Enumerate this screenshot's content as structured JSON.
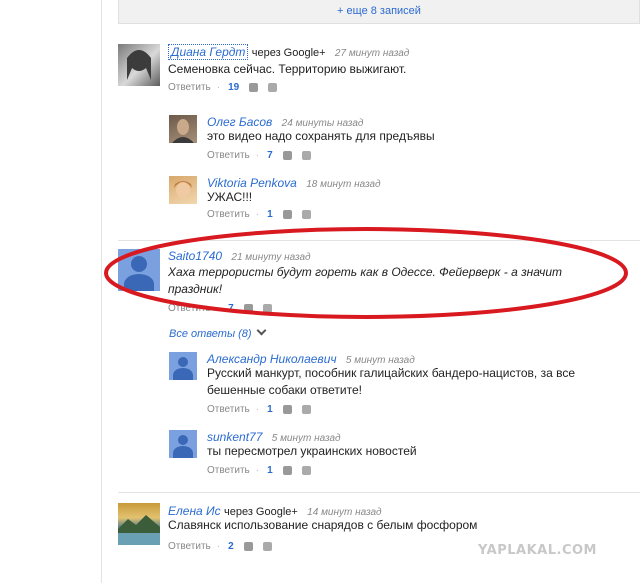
{
  "more_entries": "+ еще 8 записей",
  "reply_label": "Ответить",
  "all_answers": "Все ответы (8)",
  "watermark": "YAPLAKAL.COM",
  "comments": [
    {
      "name": "Диана Гердт",
      "via": "через Google+",
      "time": "27 минут назад",
      "text": "Семеновка сейчас. Территорию выжигают.",
      "likes": "19"
    },
    {
      "name": "Олег Басов",
      "via": "",
      "time": "24 минуты назад",
      "text": "это видео надо сохранять для предъявы",
      "likes": "7"
    },
    {
      "name": "Viktoria Penkova",
      "via": "",
      "time": "18 минут назад",
      "text": "УЖАС!!!",
      "likes": "1"
    },
    {
      "name": "Saito1740",
      "via": "",
      "time": "21 минуту назад",
      "text": "Хаха террористы будут гореть как в Одессе. Фейерверк - а значит праздник!",
      "likes": "7"
    },
    {
      "name": "Александр Николаевич",
      "via": "",
      "time": "5 минут назад",
      "text": "Русский манкурт, пособник галицайских бандеро-нацистов, за все бешенные собаки ответите!",
      "likes": "1"
    },
    {
      "name": "sunkent77",
      "via": "",
      "time": "5 минут назад",
      "text": "ты пересмотрел украинских новостей",
      "likes": "1"
    },
    {
      "name": "Елена Ис",
      "via": "через Google+",
      "time": "14 минут назад",
      "text": "Славянск использование снарядов с белым фосфором",
      "likes": "2"
    }
  ],
  "colors": {
    "link": "#2a6bd1",
    "highlight_oval": "#d8191f",
    "default_avatar": "#7aa0df"
  }
}
